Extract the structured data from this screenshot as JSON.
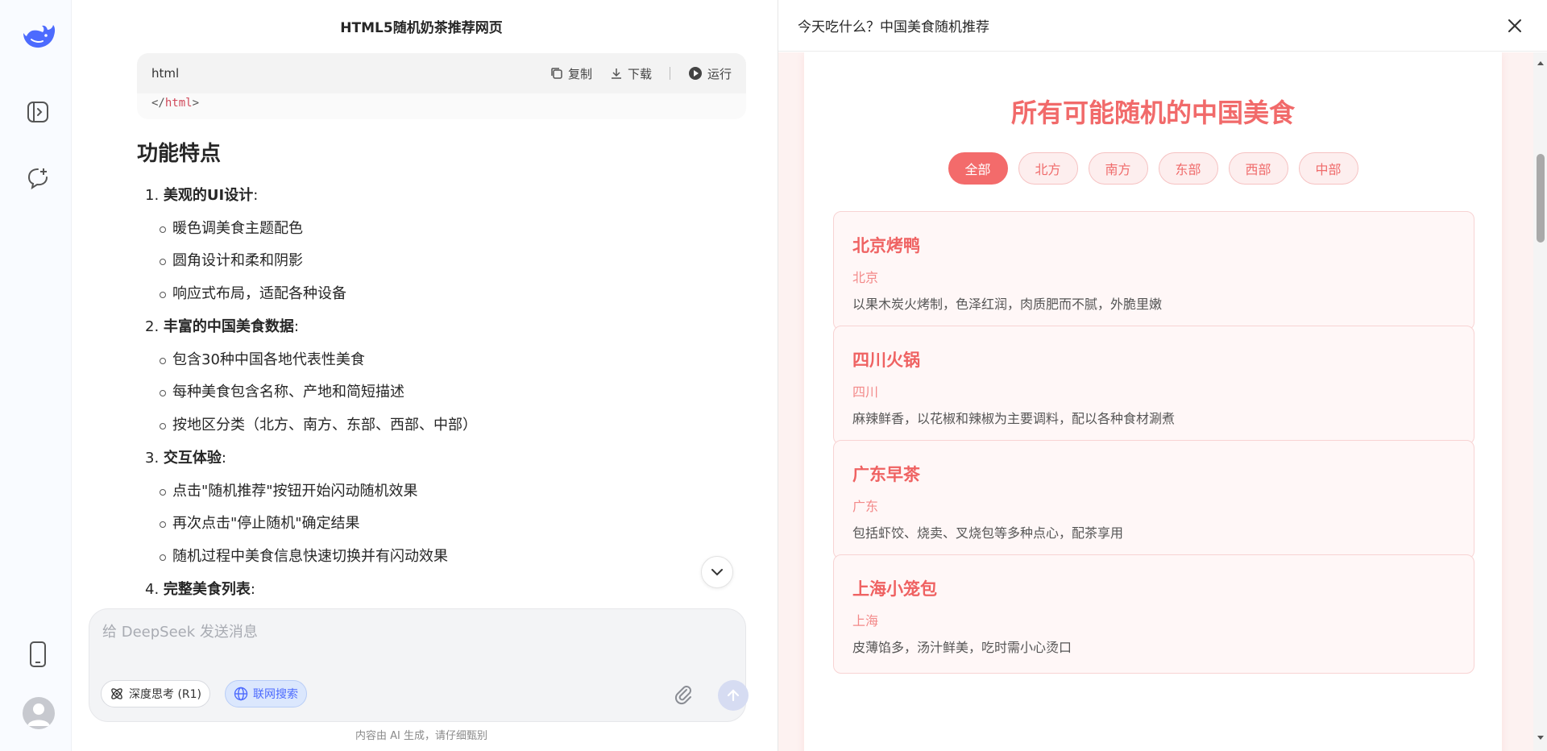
{
  "rail": {
    "icons": [
      "deepseek-whale-logo",
      "sidebar-toggle-icon",
      "new-chat-icon",
      "mobile-app-icon",
      "user-avatar"
    ]
  },
  "chat": {
    "title": "HTML5随机奶茶推荐网页",
    "code_block": {
      "language": "html",
      "copy_label": "复制",
      "download_label": "下载",
      "run_label": "运行",
      "code_line_prefix": "</",
      "code_line_tag": "html",
      "code_line_suffix": ">"
    },
    "section_heading": "功能特点",
    "features": [
      {
        "number": "1.",
        "title": "美观的UI设计",
        "colon": ":",
        "points": [
          "暖色调美食主题配色",
          "圆角设计和柔和阴影",
          "响应式布局，适配各种设备"
        ]
      },
      {
        "number": "2.",
        "title": "丰富的中国美食数据",
        "colon": ":",
        "points": [
          "包含30种中国各地代表性美食",
          "每种美食包含名称、产地和简短描述",
          "按地区分类（北方、南方、东部、西部、中部）"
        ]
      },
      {
        "number": "3.",
        "title": "交互体验",
        "colon": ":",
        "points": [
          "点击\"随机推荐\"按钮开始闪动随机效果",
          "再次点击\"停止随机\"确定结果",
          "随机过程中美食信息快速切换并有闪动效果"
        ]
      },
      {
        "number": "4.",
        "title": "完整美食列表",
        "colon": ":",
        "points": []
      }
    ],
    "input": {
      "placeholder": "给 DeepSeek 发送消息",
      "value": "",
      "deep_think_label": "深度思考 (R1)",
      "web_search_label": "联网搜索"
    },
    "disclaimer": "内容由 AI 生成，请仔细甄别"
  },
  "preview": {
    "title": "今天吃什么？中国美食随机推荐",
    "heading": "所有可能随机的中国美食",
    "filters": [
      {
        "label": "全部",
        "active": true
      },
      {
        "label": "北方",
        "active": false
      },
      {
        "label": "南方",
        "active": false
      },
      {
        "label": "东部",
        "active": false
      },
      {
        "label": "西部",
        "active": false
      },
      {
        "label": "中部",
        "active": false
      }
    ],
    "foods": [
      {
        "name": "北京烤鸭",
        "origin": "北京",
        "desc": "以果木炭火烤制，色泽红润，肉质肥而不腻，外脆里嫩"
      },
      {
        "name": "四川火锅",
        "origin": "四川",
        "desc": "麻辣鲜香，以花椒和辣椒为主要调料，配以各种食材涮煮"
      },
      {
        "name": "广东早茶",
        "origin": "广东",
        "desc": "包括虾饺、烧卖、叉烧包等多种点心，配茶享用"
      },
      {
        "name": "上海小笼包",
        "origin": "上海",
        "desc": "皮薄馅多，汤汁鲜美，吃时需小心烫口"
      }
    ],
    "accent_color": "#f16a6a"
  }
}
